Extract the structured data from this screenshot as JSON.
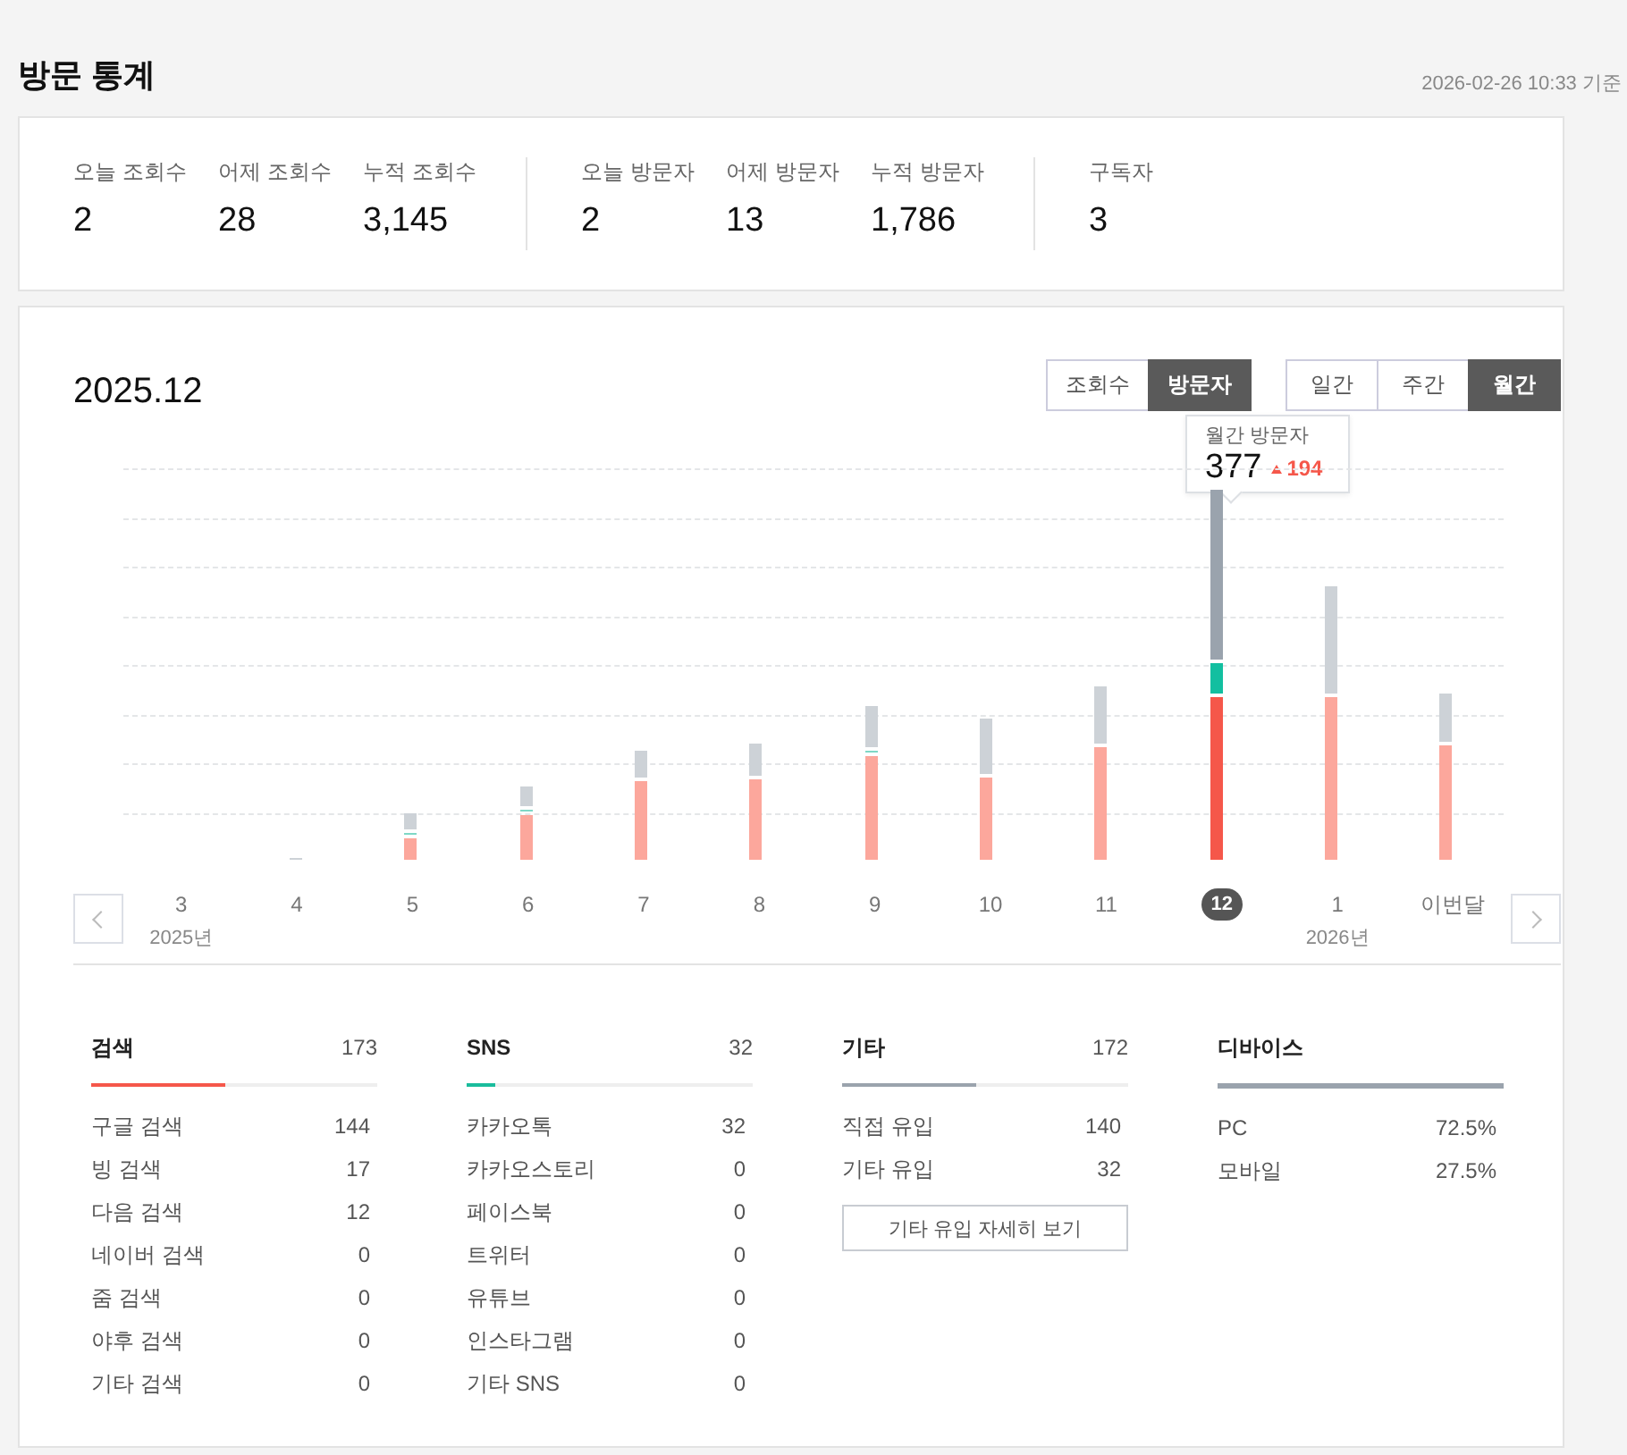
{
  "page": {
    "title": "방문 통계",
    "timestamp": "2026-02-26 10:33 기준"
  },
  "summary": [
    {
      "stats": [
        {
          "label": "오늘 조회수",
          "value": "2"
        },
        {
          "label": "어제 조회수",
          "value": "28"
        },
        {
          "label": "누적 조회수",
          "value": "3,145"
        }
      ]
    },
    {
      "stats": [
        {
          "label": "오늘 방문자",
          "value": "2"
        },
        {
          "label": "어제 방문자",
          "value": "13"
        },
        {
          "label": "누적 방문자",
          "value": "1,786"
        }
      ]
    },
    {
      "stats": [
        {
          "label": "구독자",
          "value": "3"
        }
      ]
    }
  ],
  "chart_panel": {
    "period": "2025.12",
    "metric_tabs": [
      {
        "label": "조회수",
        "selected": false
      },
      {
        "label": "방문자",
        "selected": true
      }
    ],
    "range_tabs": [
      {
        "label": "일간",
        "selected": false
      },
      {
        "label": "주간",
        "selected": false
      },
      {
        "label": "월간",
        "selected": true
      }
    ],
    "tooltip": {
      "title": "월간 방문자",
      "value": "377",
      "change": "194"
    },
    "months": [
      {
        "label": "3",
        "selected": false,
        "year": "2025년"
      },
      {
        "label": "4",
        "selected": false
      },
      {
        "label": "5",
        "selected": false
      },
      {
        "label": "6",
        "selected": false
      },
      {
        "label": "7",
        "selected": false
      },
      {
        "label": "8",
        "selected": false
      },
      {
        "label": "9",
        "selected": false
      },
      {
        "label": "10",
        "selected": false
      },
      {
        "label": "11",
        "selected": false
      },
      {
        "label": "12",
        "selected": true
      },
      {
        "label": "1",
        "selected": false,
        "year": "2026년"
      },
      {
        "label": "이번달",
        "selected": false
      }
    ]
  },
  "sources": [
    {
      "kind": "group",
      "title": "검색",
      "total": "173",
      "level": 0.47,
      "color": "#f5574a",
      "items": [
        {
          "label": "구글 검색",
          "value": "144"
        },
        {
          "label": "빙 검색",
          "value": "17"
        },
        {
          "label": "다음 검색",
          "value": "12"
        },
        {
          "label": "네이버 검색",
          "value": "0"
        },
        {
          "label": "줌 검색",
          "value": "0"
        },
        {
          "label": "야후 검색",
          "value": "0"
        },
        {
          "label": "기타 검색",
          "value": "0"
        }
      ]
    },
    {
      "kind": "group",
      "title": "SNS",
      "total": "32",
      "level": 0.1,
      "color": "#1abc9c",
      "items": [
        {
          "label": "카카오톡",
          "value": "32"
        },
        {
          "label": "카카오스토리",
          "value": "0"
        },
        {
          "label": "페이스북",
          "value": "0"
        },
        {
          "label": "트위터",
          "value": "0"
        },
        {
          "label": "유튜브",
          "value": "0"
        },
        {
          "label": "인스타그램",
          "value": "0"
        },
        {
          "label": "기타 SNS",
          "value": "0"
        }
      ]
    },
    {
      "kind": "group",
      "title": "기타",
      "total": "172",
      "level": 0.47,
      "color": "#9aa3ad",
      "items": [
        {
          "label": "직접 유입",
          "value": "140"
        },
        {
          "label": "기타 유입",
          "value": "32"
        }
      ],
      "button": "기타 유입 자세히 보기"
    },
    {
      "kind": "device",
      "title": "디바이스",
      "items": [
        {
          "label": "PC",
          "value": "72.5%"
        },
        {
          "label": "모바일",
          "value": "27.5%"
        }
      ]
    }
  ]
}
